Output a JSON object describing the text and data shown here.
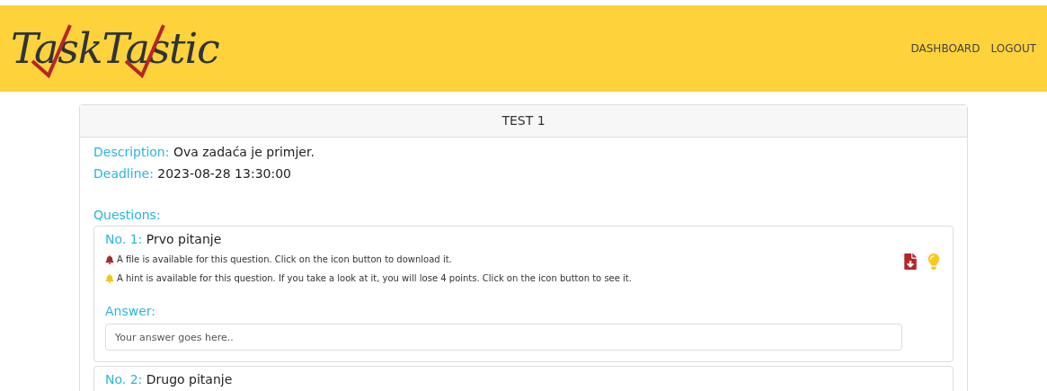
{
  "header": {
    "logo": "TaskTastic",
    "nav": [
      {
        "label": "DASHBOARD"
      },
      {
        "label": "LOGOUT"
      }
    ]
  },
  "test": {
    "title": "TEST 1",
    "description_label": "Description:",
    "description": "Ova zadaća je primjer.",
    "deadline_label": "Deadline:",
    "deadline": "2023-08-28 13:30:00",
    "questions_label": "Questions:",
    "questions": [
      {
        "number": "No. 1:",
        "title": "Prvo pitanje",
        "notes": [
          {
            "kind": "file",
            "text": "A file is available for this question. Click on the icon button to download it."
          },
          {
            "kind": "hint",
            "text": "A hint is available for this question. If you take a look at it, you will lose 4 points. Click on the icon button to see it."
          }
        ],
        "answer_label": "Answer:",
        "answer_placeholder": "Your answer goes here.."
      },
      {
        "number": "No. 2:",
        "title": "Drugo pitanje"
      }
    ]
  }
}
